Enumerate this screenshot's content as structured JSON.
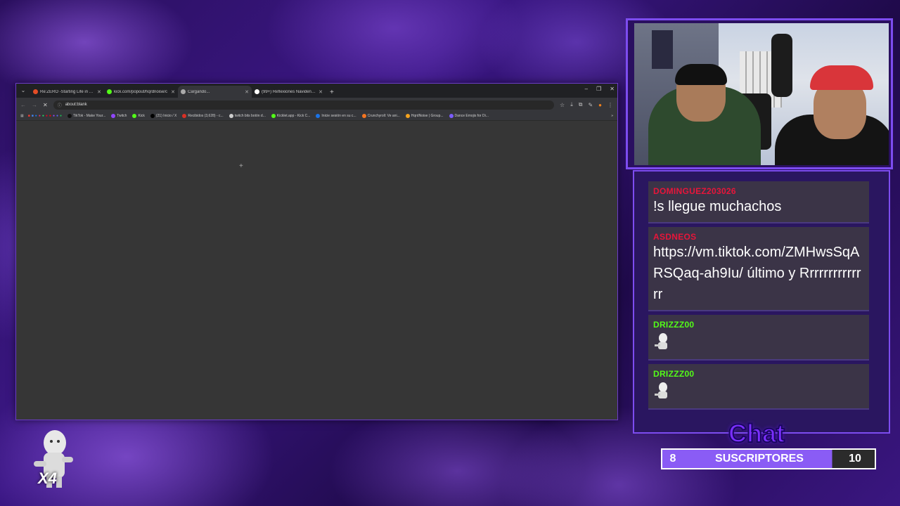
{
  "browser": {
    "tabs": [
      {
        "title": "Re:ZERO -Starting Life in Anoth",
        "color": "#e44d26",
        "active": false
      },
      {
        "title": "kick.com/popout/hqrdnoise/c",
        "color": "#53fc18",
        "active": false
      },
      {
        "title": "Cargando...",
        "color": "#aaaaaa",
        "active": true
      },
      {
        "title": "(99+) Reflexiones Navideñas sob",
        "color": "#ffffff",
        "active": false
      }
    ],
    "new_tab": "+",
    "window_controls": [
      "–",
      "❐",
      "✕"
    ],
    "url": "about:blank",
    "bookmarks": [
      {
        "label": "TikTok - Make Your...",
        "color": "#111111"
      },
      {
        "label": "Twitch",
        "color": "#9146ff"
      },
      {
        "label": "Kick",
        "color": "#53fc18"
      },
      {
        "label": "(21) Inicio / X",
        "color": "#000000"
      },
      {
        "label": "Recibidos (3,628) - c...",
        "color": "#d93025"
      },
      {
        "label": "twitch bits botón d...",
        "color": "#cccccc"
      },
      {
        "label": "Kicklet.app - Kick C...",
        "color": "#53fc18"
      },
      {
        "label": "Inicie sesión en su c...",
        "color": "#1a73e8"
      },
      {
        "label": "Crunchyroll: Ve ani...",
        "color": "#f47521"
      },
      {
        "label": "HqrdNoise | Group...",
        "color": "#f4a21e"
      },
      {
        "label": "Dance Emojis for Di...",
        "color": "#7b5cff"
      }
    ],
    "more": "»"
  },
  "chat": {
    "messages": [
      {
        "user": "DOMINGUEZ203026",
        "user_color": "#e8153a",
        "text": "!s llegue muchachos",
        "emote": false
      },
      {
        "user": "ASDNEOS",
        "user_color": "#e8153a",
        "text": "https://vm.tiktok.com/ZMHwsSqARSQaq-ah9Iu/ último y Rrrrrrrrrrrrrr",
        "emote": false
      },
      {
        "user": "DRIZZZ00",
        "user_color": "#53fc18",
        "text": "",
        "emote": true
      },
      {
        "user": "DRIZZZ00",
        "user_color": "#53fc18",
        "text": "",
        "emote": true
      }
    ],
    "title": "Chat"
  },
  "subs": {
    "current": "8",
    "label": "SUSCRIPTORES",
    "goal": "10",
    "progress": 0.8
  },
  "overlay": {
    "multiplier": "X4"
  }
}
